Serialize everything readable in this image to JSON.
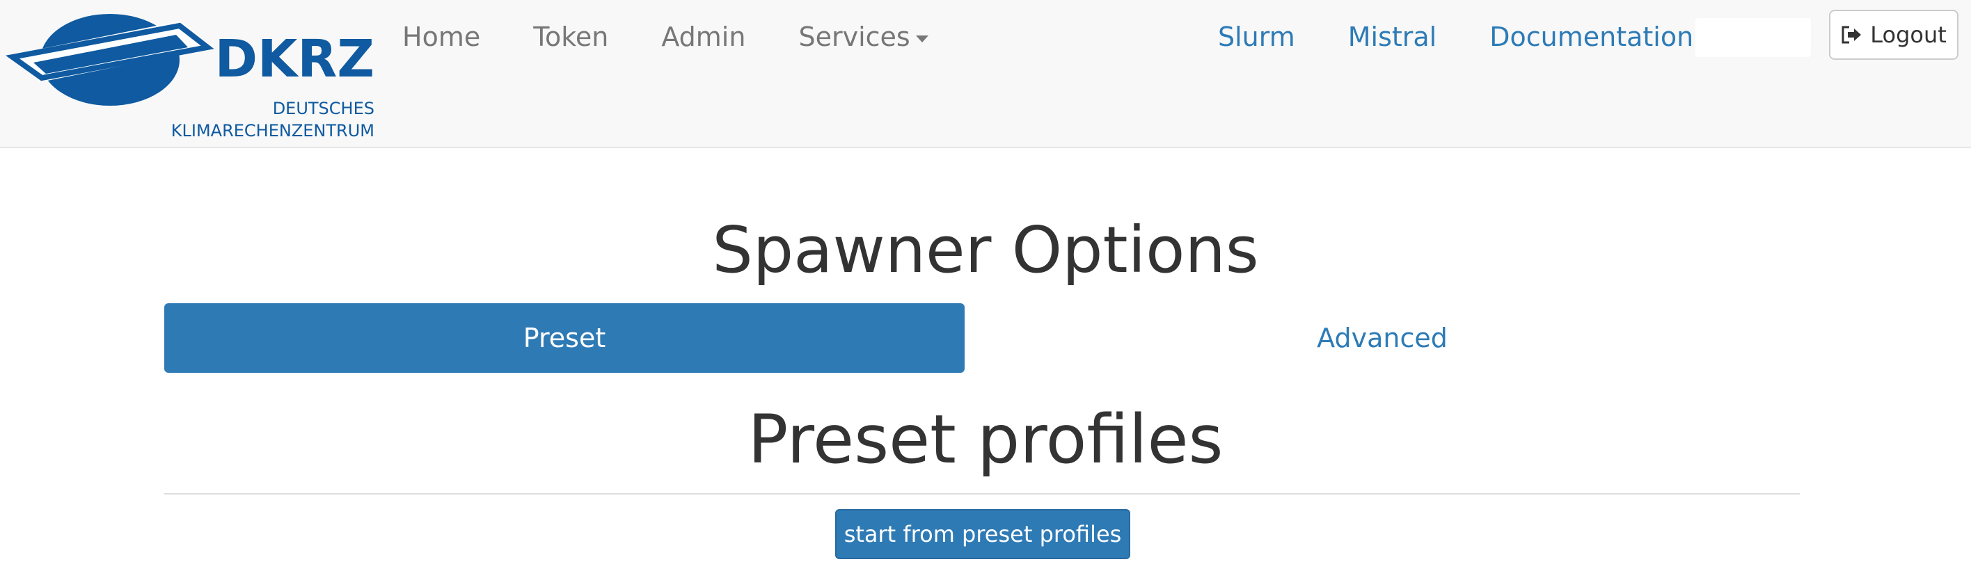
{
  "brand": {
    "name": "DKRZ",
    "line1": "DEUTSCHES",
    "line2": "KLIMARECHENZENTRUM",
    "color": "#0f5aa0"
  },
  "nav": {
    "left": [
      "Home",
      "Token",
      "Admin",
      "Services"
    ],
    "right": [
      "Slurm",
      "Mistral",
      "Documentation"
    ],
    "logout_label": "Logout"
  },
  "main": {
    "title": "Spawner Options",
    "tabs": {
      "preset": "Preset",
      "advanced": "Advanced",
      "active": "Preset"
    },
    "section_title": "Preset profiles",
    "start_button": "start from preset profiles"
  },
  "colors": {
    "primary": "#2e7ab5",
    "link": "#2d7bb6",
    "navbar_bg": "#f8f8f8"
  },
  "icons": {
    "services_dropdown": "caret-down-icon",
    "logout": "sign-out-icon"
  }
}
